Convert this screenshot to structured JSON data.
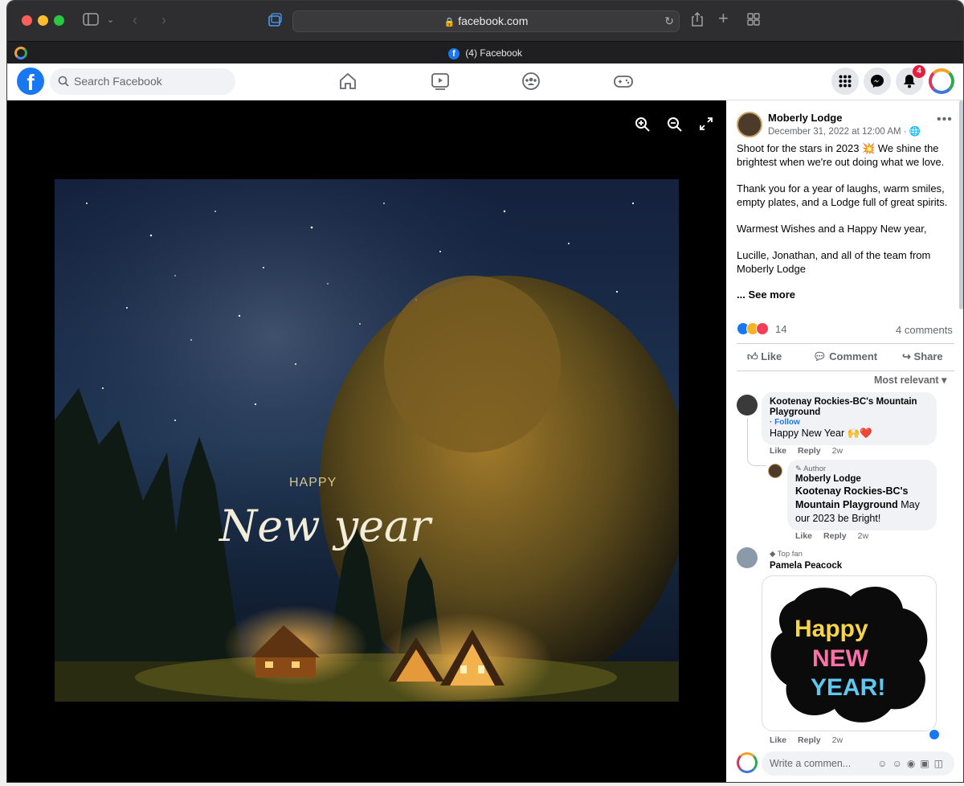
{
  "browser": {
    "url": "facebook.com",
    "tab_title": "(4) Facebook"
  },
  "header": {
    "search_placeholder": "Search Facebook",
    "notification_count": "4"
  },
  "post": {
    "page_name": "Moberly Lodge",
    "date": "December 31, 2022 at 12:00 AM ·",
    "text_lines": [
      "Shoot for the stars in 2023 💥 We shine the brightest when we're out doing what we love.",
      "Thank you for a year of laughs, warm smiles, empty plates, and a Lodge full of great spirits.",
      "Warmest Wishes and a Happy New year,",
      "Lucille, Jonathan, and all of the team from Moberly Lodge"
    ],
    "see_more": "... See more",
    "reaction_count": "14",
    "comment_count": "4 comments",
    "actions": {
      "like": "Like",
      "comment": "Comment",
      "share": "Share"
    },
    "sort_label": "Most relevant",
    "image_text": {
      "happy": "HAPPY",
      "new_year": "New year"
    }
  },
  "comments": [
    {
      "author": "Kootenay Rockies-BC's Mountain Playground",
      "follow": "· Follow",
      "text": "Happy New Year 🙌❤️",
      "like": "Like",
      "reply": "Reply",
      "time": "2w"
    },
    {
      "badge": "Author",
      "author": "Moberly Lodge",
      "mention": "Kootenay Rockies-BC's Mountain Playground",
      "text": " May our 2023 be Bright!",
      "like": "Like",
      "reply": "Reply",
      "time": "2w"
    },
    {
      "badge": "Top fan",
      "author": "Pamela Peacock",
      "sticker_text": [
        "Happy",
        "NEW",
        "YEAR!"
      ],
      "like": "Like",
      "reply": "Reply",
      "time": "2w"
    }
  ],
  "composer": {
    "placeholder": "Write a commen..."
  },
  "colors": {
    "brand": "#1877f2",
    "badge": "#e41e3f"
  }
}
